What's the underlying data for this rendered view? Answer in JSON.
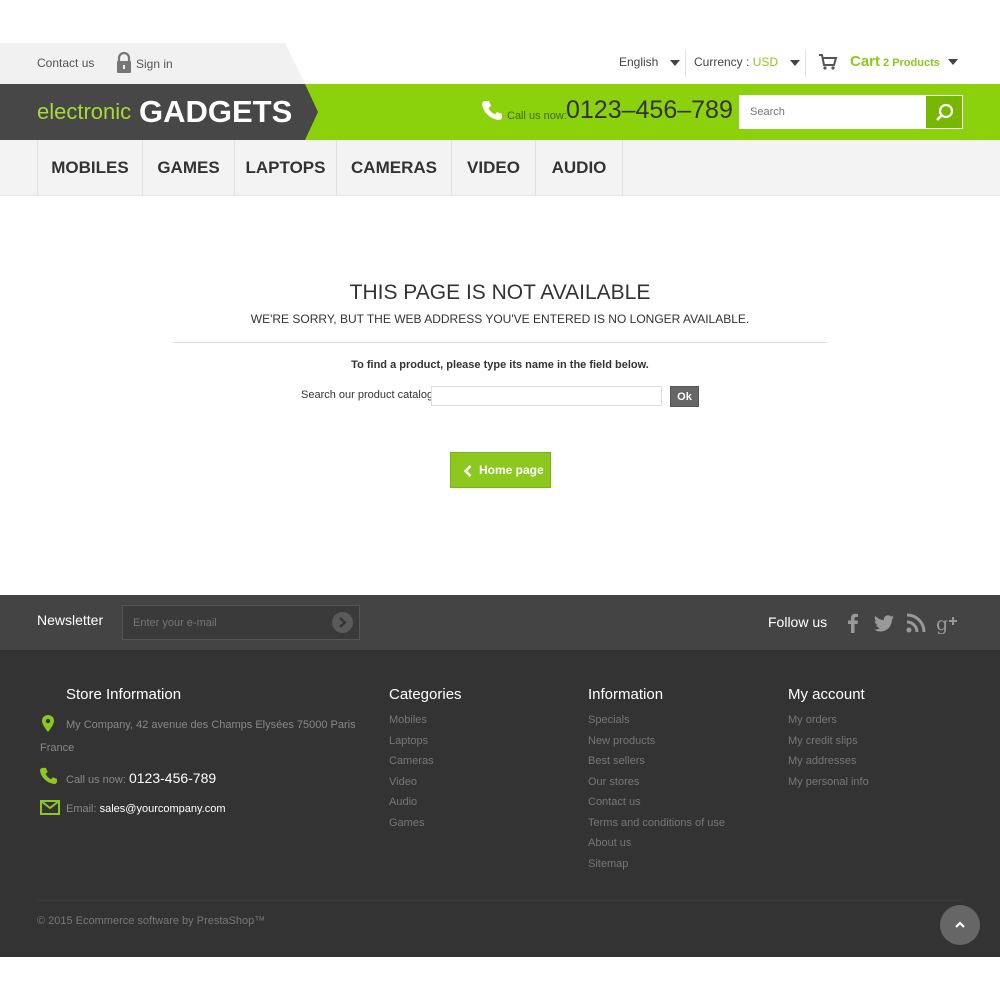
{
  "topbar": {
    "contact": "Contact us",
    "signin": "Sign in",
    "language": "English",
    "currency_label": "Currency :",
    "currency_value": "USD",
    "cart_label": "Cart",
    "cart_count": "2 Products"
  },
  "header": {
    "logo_small": "electronic",
    "logo_big": "GADGETS",
    "call_label": "Call us now:",
    "call_number": "0123–456–789",
    "search_placeholder": "Search"
  },
  "nav": {
    "items": [
      "MOBILES",
      "GAMES",
      "LAPTOPS",
      "CAMERAS",
      "VIDEO",
      "AUDIO"
    ]
  },
  "main": {
    "title": "THIS PAGE IS NOT AVAILABLE",
    "subtitle": "WE'RE SORRY, BUT THE WEB ADDRESS YOU'VE ENTERED IS NO LONGER AVAILABLE.",
    "find_text": "To find a product, please type its name in the field below.",
    "catalog_label": "Search our product catalog:",
    "ok_label": "Ok",
    "home_label": "Home page"
  },
  "newsletter": {
    "label": "Newsletter",
    "placeholder": "Enter your e-mail",
    "follow": "Follow us"
  },
  "footer": {
    "store_title": "Store Information",
    "address": "My Company, 42 avenue des Champs Elysées 75000 Paris France",
    "call_label": "Call us now:",
    "phone": "0123-456-789",
    "email_label": "Email:",
    "email": "sales@yourcompany.com",
    "categories_title": "Categories",
    "categories": [
      "Mobiles",
      "Laptops",
      "Cameras",
      "Video",
      "Audio",
      "Games"
    ],
    "information_title": "Information",
    "information": [
      "Specials",
      "New products",
      "Best sellers",
      "Our stores",
      "Contact us",
      "Terms and conditions of use",
      "About us",
      "Sitemap"
    ],
    "account_title": "My account",
    "account": [
      "My orders",
      "My credit slips",
      "My addresses",
      "My personal info"
    ],
    "copyright": "© 2015 Ecommerce software by PrestaShop™"
  },
  "colors": {
    "accent": "#8cc81e",
    "header_green": "#8cd20c",
    "dark": "#333333"
  }
}
